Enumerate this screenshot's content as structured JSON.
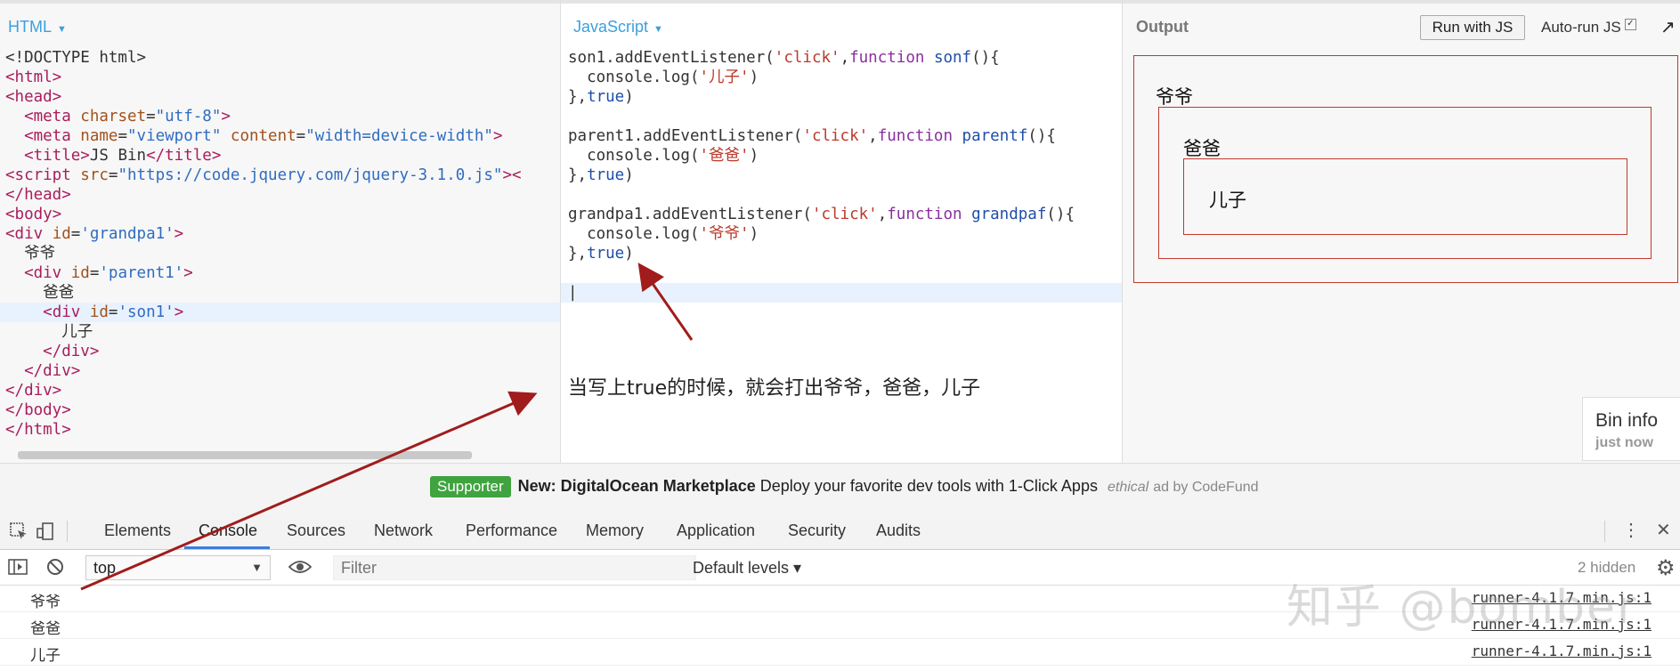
{
  "html_panel": {
    "label": "HTML",
    "lines": [
      [
        {
          "t": "<!DOCTYPE html>",
          "c": ""
        }
      ],
      [
        {
          "t": "<html>",
          "c": "t-tag"
        }
      ],
      [
        {
          "t": "<head>",
          "c": "t-tag"
        }
      ],
      [
        {
          "t": "  "
        },
        {
          "t": "<meta ",
          "c": "t-tag"
        },
        {
          "t": "charset",
          "c": "t-attr"
        },
        {
          "t": "="
        },
        {
          "t": "\"utf-8\"",
          "c": "t-str"
        },
        {
          "t": ">",
          "c": "t-tag"
        }
      ],
      [
        {
          "t": "  "
        },
        {
          "t": "<meta ",
          "c": "t-tag"
        },
        {
          "t": "name",
          "c": "t-attr"
        },
        {
          "t": "="
        },
        {
          "t": "\"viewport\"",
          "c": "t-str"
        },
        {
          "t": " "
        },
        {
          "t": "content",
          "c": "t-attr"
        },
        {
          "t": "="
        },
        {
          "t": "\"width=device-width\"",
          "c": "t-str"
        },
        {
          "t": ">",
          "c": "t-tag"
        }
      ],
      [
        {
          "t": "  "
        },
        {
          "t": "<title>",
          "c": "t-tag"
        },
        {
          "t": "JS Bin"
        },
        {
          "t": "</title>",
          "c": "t-tag"
        }
      ],
      [
        {
          "t": "<script ",
          "c": "t-tag"
        },
        {
          "t": "src",
          "c": "t-attr"
        },
        {
          "t": "="
        },
        {
          "t": "\"https://code.jquery.com/jquery-3.1.0.js\"",
          "c": "t-str"
        },
        {
          "t": "><",
          "c": "t-tag"
        }
      ],
      [
        {
          "t": "</head>",
          "c": "t-tag"
        }
      ],
      [
        {
          "t": "<body>",
          "c": "t-tag"
        }
      ],
      [
        {
          "t": "<div ",
          "c": "t-tag"
        },
        {
          "t": "id",
          "c": "t-attr"
        },
        {
          "t": "="
        },
        {
          "t": "'grandpa1'",
          "c": "t-str"
        },
        {
          "t": ">",
          "c": "t-tag"
        }
      ],
      [
        {
          "t": "  爷爷"
        }
      ],
      [
        {
          "t": "  "
        },
        {
          "t": "<div ",
          "c": "t-tag"
        },
        {
          "t": "id",
          "c": "t-attr"
        },
        {
          "t": "="
        },
        {
          "t": "'parent1'",
          "c": "t-str"
        },
        {
          "t": ">",
          "c": "t-tag"
        }
      ],
      [
        {
          "t": "    爸爸"
        }
      ],
      [
        {
          "t": "    "
        },
        {
          "t": "<div ",
          "c": "t-tag"
        },
        {
          "t": "id",
          "c": "t-attr"
        },
        {
          "t": "="
        },
        {
          "t": "'son1'",
          "c": "t-str"
        },
        {
          "t": ">",
          "c": "t-tag"
        }
      ],
      [
        {
          "t": "      儿子"
        }
      ],
      [
        {
          "t": "    "
        },
        {
          "t": "</div>",
          "c": "t-tag"
        }
      ],
      [
        {
          "t": "  "
        },
        {
          "t": "</div>",
          "c": "t-tag"
        }
      ],
      [
        {
          "t": "</div>",
          "c": "t-tag"
        }
      ],
      [
        {
          "t": "</body>",
          "c": "t-tag"
        }
      ],
      [
        {
          "t": "</html>",
          "c": "t-tag"
        }
      ]
    ]
  },
  "js_panel": {
    "label": "JavaScript",
    "lines": [
      [
        {
          "t": "son1.addEventListener("
        },
        {
          "t": "'click'",
          "c": "t-jstr"
        },
        {
          "t": ","
        },
        {
          "t": "function ",
          "c": "t-kw"
        },
        {
          "t": "sonf",
          "c": "t-fn"
        },
        {
          "t": "(){"
        }
      ],
      [
        {
          "t": "  console.log("
        },
        {
          "t": "'儿子'",
          "c": "t-jstr"
        },
        {
          "t": ")"
        }
      ],
      [
        {
          "t": "},"
        },
        {
          "t": "true",
          "c": "t-fn"
        },
        {
          "t": ")"
        }
      ],
      [
        {
          "t": ""
        }
      ],
      [
        {
          "t": "parent1.addEventListener("
        },
        {
          "t": "'click'",
          "c": "t-jstr"
        },
        {
          "t": ","
        },
        {
          "t": "function ",
          "c": "t-kw"
        },
        {
          "t": "parentf",
          "c": "t-fn"
        },
        {
          "t": "(){"
        }
      ],
      [
        {
          "t": "  console.log("
        },
        {
          "t": "'爸爸'",
          "c": "t-jstr"
        },
        {
          "t": ")"
        }
      ],
      [
        {
          "t": "},"
        },
        {
          "t": "true",
          "c": "t-fn"
        },
        {
          "t": ")"
        }
      ],
      [
        {
          "t": ""
        }
      ],
      [
        {
          "t": "grandpa1.addEventListener("
        },
        {
          "t": "'click'",
          "c": "t-jstr"
        },
        {
          "t": ","
        },
        {
          "t": "function ",
          "c": "t-kw"
        },
        {
          "t": "grandpaf",
          "c": "t-fn"
        },
        {
          "t": "(){"
        }
      ],
      [
        {
          "t": "  console.log("
        },
        {
          "t": "'爷爷'",
          "c": "t-jstr"
        },
        {
          "t": ")"
        }
      ],
      [
        {
          "t": "},"
        },
        {
          "t": "true",
          "c": "t-fn"
        },
        {
          "t": ")"
        }
      ],
      [
        {
          "t": ""
        }
      ],
      [
        {
          "t": "|"
        }
      ]
    ]
  },
  "output_panel": {
    "label": "Output",
    "run_button": "Run with JS",
    "autorun_label": "Auto-run JS",
    "autorun_check": "✓",
    "expand_icon": "↗",
    "boxes": {
      "grandpa": "爷爷",
      "parent": "爸爸",
      "son": "儿子"
    },
    "bin_info_title": "Bin info",
    "bin_info_time": "just now"
  },
  "annotation": "当写上true的时候，就会打出爷爷，爸爸，儿子",
  "ad": {
    "badge": "Supporter",
    "headline": "New: DigitalOcean Marketplace",
    "text": "Deploy your favorite dev tools with 1-Click Apps",
    "ethical": "ethical",
    "by": "ad by CodeFund"
  },
  "devtools": {
    "tabs": [
      "Elements",
      "Console",
      "Sources",
      "Network",
      "Performance",
      "Memory",
      "Application",
      "Security",
      "Audits"
    ],
    "active_tab": "Console",
    "context": "top",
    "filter_placeholder": "Filter",
    "levels": "Default levels ▾",
    "hidden": "2 hidden",
    "logs": [
      {
        "msg": "爷爷",
        "src": "runner-4.1.7.min.js:1"
      },
      {
        "msg": "爸爸",
        "src": "runner-4.1.7.min.js:1"
      },
      {
        "msg": "儿子",
        "src": "runner-4.1.7.min.js:1"
      }
    ]
  },
  "watermark": "知乎 @bomber",
  "colors": {
    "accent": "#3aa0df",
    "box_border": "#c0392b",
    "arrow": "#a11c1c",
    "badge": "#3fa33f"
  }
}
